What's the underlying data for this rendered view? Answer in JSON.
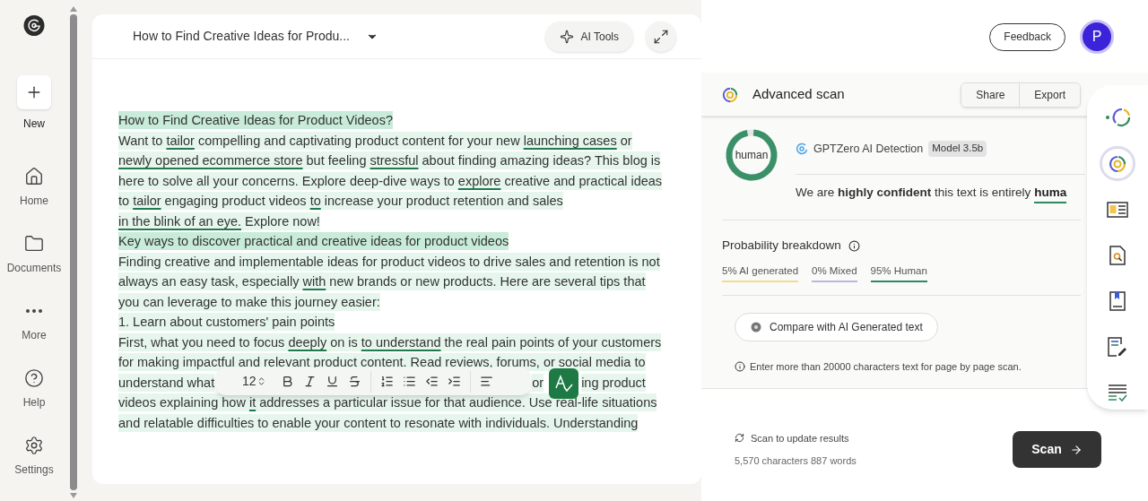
{
  "sidebar": {
    "items": [
      {
        "kind": "new",
        "label": "New"
      },
      {
        "kind": "home",
        "label": "Home"
      },
      {
        "kind": "folder",
        "label": "Documents"
      },
      {
        "kind": "more",
        "label": "More"
      },
      {
        "kind": "help",
        "label": "Help"
      },
      {
        "kind": "settings",
        "label": "Settings"
      }
    ]
  },
  "editor": {
    "title": "How to Find Creative Ideas for Produ...",
    "ai_tools": "AI Tools",
    "lines": [
      {
        "kind": "heading",
        "segments": [
          {
            "text": "How to Find Creative Ideas for Product Videos?",
            "underlined": false
          }
        ]
      },
      {
        "kind": "body",
        "segments": [
          {
            "text": "Want to ",
            "underlined": false
          },
          {
            "text": "tailor",
            "underlined": true
          },
          {
            "text": " compelling and captivating product content for your new ",
            "underlined": false
          },
          {
            "text": "launching cases",
            "underlined": true
          },
          {
            "text": " or",
            "underlined": false
          }
        ]
      },
      {
        "kind": "body",
        "segments": [
          {
            "text": "newly opened ecommerce store",
            "underlined": true
          },
          {
            "text": " but feeling ",
            "underlined": false
          },
          {
            "text": "stressful",
            "underlined": true
          },
          {
            "text": " about finding amazing ideas? This blog is",
            "underlined": false
          }
        ]
      },
      {
        "kind": "body",
        "segments": [
          {
            "text": "here to solve all your concerns. Explore deep-dive ways to ",
            "underlined": false
          },
          {
            "text": "explore",
            "underlined": true
          },
          {
            "text": " creative and practical ideas",
            "underlined": false
          }
        ]
      },
      {
        "kind": "body",
        "segments": [
          {
            "text": "to ",
            "underlined": false
          },
          {
            "text": "tailor",
            "underlined": true
          },
          {
            "text": " engaging product videos ",
            "underlined": false
          },
          {
            "text": "to",
            "underlined": true
          },
          {
            "text": " increase your product retention and sales",
            "underlined": false
          }
        ]
      },
      {
        "kind": "body",
        "segments": [
          {
            "text": "in the blink of an eye.",
            "underlined": true
          },
          {
            "text": " Explore now!",
            "underlined": false
          }
        ]
      },
      {
        "kind": "heading",
        "segments": [
          {
            "text": "Key ways to discover practical and creative ideas for product videos",
            "underlined": false
          }
        ]
      },
      {
        "kind": "body",
        "segments": [
          {
            "text": "Finding creative and implementable ideas for product videos to drive sales and retention is not",
            "underlined": false
          }
        ]
      },
      {
        "kind": "body",
        "segments": [
          {
            "text": "always an easy task, especially ",
            "underlined": false
          },
          {
            "text": "with",
            "underlined": true
          },
          {
            "text": " new brands or new products. Here are several tips that",
            "underlined": false
          }
        ]
      },
      {
        "kind": "body",
        "segments": [
          {
            "text": "you can leverage to make this journey easier:",
            "underlined": false
          }
        ]
      },
      {
        "kind": "body",
        "segments": [
          {
            "text": "1. Learn about customers' pain points",
            "underlined": false
          }
        ]
      },
      {
        "kind": "body",
        "segments": [
          {
            "text": "First, what you need to focus ",
            "underlined": false
          },
          {
            "text": "deeply",
            "underlined": true
          },
          {
            "text": " on is ",
            "underlined": false
          },
          {
            "text": "to understand",
            "underlined": true
          },
          {
            "text": " the real pain points of your customers",
            "underlined": false
          }
        ]
      },
      {
        "kind": "body",
        "segments": [
          {
            "text": "for making impactful and relevant product content. Read reviews, forums, or social media to",
            "underlined": false
          }
        ]
      },
      {
        "kind": "covered",
        "segments": [
          {
            "text": "understand what",
            "underlined": false
          },
          {
            "text": "or",
            "underlined": false
          },
          {
            "text": "ing product",
            "underlined": false
          }
        ]
      },
      {
        "kind": "body",
        "segments": [
          {
            "text": "videos explaining how ",
            "underlined": false
          },
          {
            "text": "it",
            "underlined": true
          },
          {
            "text": " addresses a particular issue for that audience. Use real-life situations",
            "underlined": false
          }
        ]
      },
      {
        "kind": "body",
        "segments": [
          {
            "text": "and relatable difficulties to enable your content to resonate with individuals. Understanding",
            "underlined": false
          }
        ]
      }
    ],
    "toolbar": {
      "font_size": "12"
    }
  },
  "panel": {
    "feedback": "Feedback",
    "avatar": "P",
    "scan_title": "Advanced scan",
    "actions": [
      "Share",
      "Export"
    ],
    "result": {
      "label": "human",
      "level": 0.95
    },
    "detector": "GPTZero AI Detection",
    "model": "Model 3.5b",
    "verdict": "We are **highly confident** this text is entirely",
    "verdict_tail": "huma",
    "breakdown_title": "Probability breakdown",
    "breakdown": [
      {
        "label": "5% AI generated",
        "color": "#f1dc8e"
      },
      {
        "label": "0% Mixed",
        "color": "#bcb5dd"
      },
      {
        "label": "95% Human",
        "color": "#2f8a5f"
      }
    ],
    "compare": "Compare with AI Generated text",
    "note": "Enter more than 20000 characters text for page by page scan.",
    "update": "Scan to update results",
    "counts": "5,570 characters 887 words",
    "scan": "Scan"
  },
  "rail": [
    {
      "kind": "progress",
      "selected": false
    },
    {
      "kind": "scan",
      "selected": true
    },
    {
      "kind": "idcard",
      "selected": false
    },
    {
      "kind": "docsearch",
      "selected": false
    },
    {
      "kind": "bookmark",
      "selected": false
    },
    {
      "kind": "docedit",
      "selected": false
    },
    {
      "kind": "checklist",
      "selected": false
    }
  ]
}
